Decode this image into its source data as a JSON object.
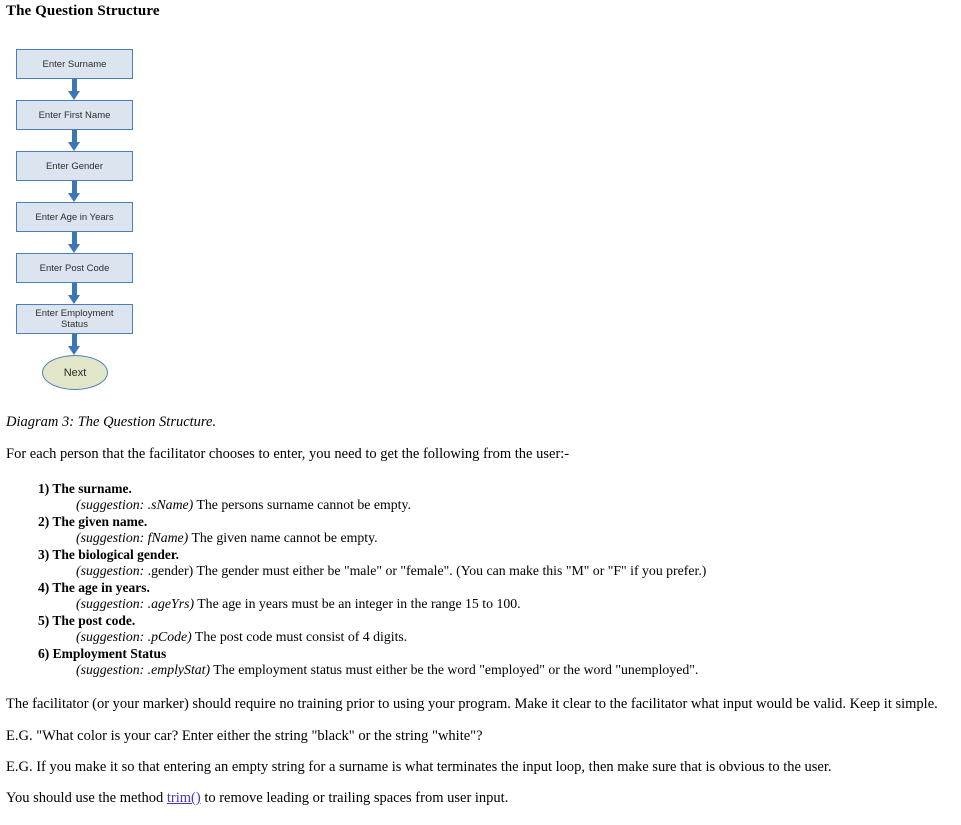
{
  "document": {
    "title": "The Question Structure"
  },
  "diagram": {
    "caption": "Diagram 3: The Question Structure.",
    "node_fill": "#dce4f0",
    "node_border": "#4a7ebb",
    "terminal_fill": "#e2e6c8",
    "arrow_color": "#3d76b4",
    "nodes": [
      {
        "label": "Enter Surname",
        "shape": "rect"
      },
      {
        "label": "Enter First Name",
        "shape": "rect"
      },
      {
        "label": "Enter Gender",
        "shape": "rect"
      },
      {
        "label": "Enter Age in Years",
        "shape": "rect"
      },
      {
        "label": "Enter Post Code",
        "shape": "rect"
      },
      {
        "label": "Enter Employment Status",
        "shape": "rect",
        "line1": "Enter Employment",
        "line2": "Status"
      },
      {
        "label": "Next",
        "shape": "oval"
      }
    ]
  },
  "body": {
    "intro": "For each person that the facilitator chooses to enter, you need to get the following from the user:-",
    "facilitator_note": "The facilitator (or your marker) should require no training prior to using your program. Make it clear to the facilitator what input would be valid. Keep it simple.",
    "example_one": "E.G. \"What color is your car? Enter either the string \"black\" or the string \"white\"?",
    "example_two": "E.G. If you make it so that entering an empty string for a surname is what terminates the input loop, then make sure that is obvious to the user.",
    "trim_prefix": "You should use the method ",
    "trim_link": "trim()",
    "trim_suffix": " to remove leading or trailing spaces from user input.",
    "link_color": "#4a36c8"
  },
  "requirements": [
    {
      "number": "1)",
      "heading": "1) The surname.",
      "suggestion_tag": "(suggestion: .sName)",
      "suggestion_text": " The persons surname cannot be empty."
    },
    {
      "number": "2)",
      "heading": "2) The given name.",
      "suggestion_tag": "(suggestion:  fName)",
      "suggestion_text": " The given name cannot be empty."
    },
    {
      "number": "3)",
      "heading": "3) The biological gender.",
      "suggestion_tag": "(suggestion:",
      "suggestion_text": " .gender) The gender must either be \"male\" or \"female\". (You can make this \"M\" or \"F\" if you prefer.)"
    },
    {
      "number": "4)",
      "heading": "4) The age in years.",
      "suggestion_tag": "(suggestion: .ageYrs)",
      "suggestion_text": " The age in years must be an integer in the range 15 to 100."
    },
    {
      "number": "5)",
      "heading": "5) The post code.",
      "suggestion_tag": "(suggestion: .pCode)",
      "suggestion_text": " The post code must consist of 4 digits."
    },
    {
      "number": "6)",
      "heading": "6) Employment Status",
      "suggestion_tag": "(suggestion: .emplyStat)",
      "suggestion_text": " The employment status must either be the word \"employed\" or the word \"unemployed\"."
    }
  ]
}
